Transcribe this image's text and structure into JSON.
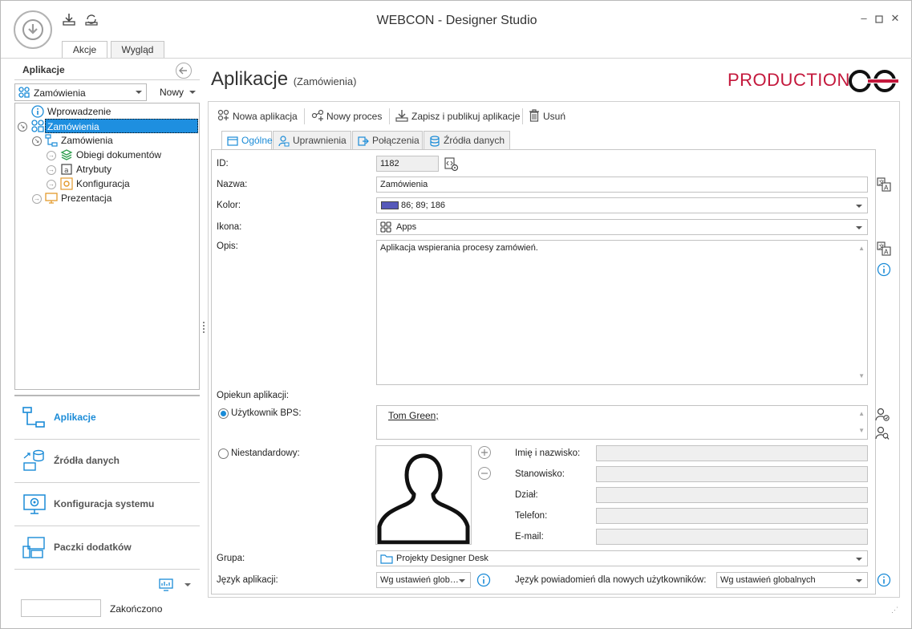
{
  "window": {
    "title": "WEBCON - Designer Studio",
    "ribbon_tabs": [
      "Akcje",
      "Wygląd"
    ]
  },
  "left": {
    "title": "Aplikacje",
    "app_select": "Zamówienia",
    "new_button": "Nowy",
    "tree": [
      {
        "label": "Wprowadzenie"
      },
      {
        "label": "Zamówienia"
      },
      {
        "label": "Zamówienia"
      },
      {
        "label": "Obiegi dokumentów"
      },
      {
        "label": "Atrybuty"
      },
      {
        "label": "Konfiguracja"
      },
      {
        "label": "Prezentacja"
      }
    ],
    "nav": [
      {
        "label": "Aplikacje"
      },
      {
        "label": "Źródła danych"
      },
      {
        "label": "Konfiguracja systemu"
      },
      {
        "label": "Paczki dodatków"
      }
    ],
    "status": "Zakończono"
  },
  "main": {
    "heading": "Aplikacje",
    "heading_sub": "(Zamówienia)",
    "environment": "PRODUCTION",
    "toolbar": {
      "new_app": "Nowa aplikacja",
      "new_process": "Nowy proces",
      "save_publish": "Zapisz i publikuj aplikacje",
      "delete": "Usuń"
    },
    "tabs": [
      "Ogólne",
      "Uprawnienia",
      "Połączenia",
      "Źródła danych"
    ],
    "form": {
      "id_label": "ID:",
      "id_value": "1182",
      "name_label": "Nazwa:",
      "name_value": "Zamówienia",
      "color_label": "Kolor:",
      "color_value": "86; 89; 186",
      "color_swatch": "#5659ba",
      "icon_label": "Ikona:",
      "icon_value": "Apps",
      "desc_label": "Opis:",
      "desc_value": "Aplikacja wspierania procesy zamówień.",
      "owner_label": "Opiekun aplikacji:",
      "bps_user_label": "Użytkownik BPS:",
      "bps_user_value": "Tom Green;",
      "custom_label": "Niestandardowy:",
      "person_fields": {
        "name": "Imię i nazwisko:",
        "position": "Stanowisko:",
        "department": "Dział:",
        "phone": "Telefon:",
        "email": "E-mail:"
      },
      "group_label": "Grupa:",
      "group_value": "Projekty Designer Desk",
      "lang_label": "Język aplikacji:",
      "lang_value": "Wg ustawień glob…",
      "notif_lang_label": "Język powiadomień dla nowych użytkowników:",
      "notif_lang_value": "Wg ustawień globalnych"
    }
  },
  "colors": {
    "accent": "#1a8bd7",
    "selection": "#1e8fe0",
    "production": "#c4183c"
  }
}
